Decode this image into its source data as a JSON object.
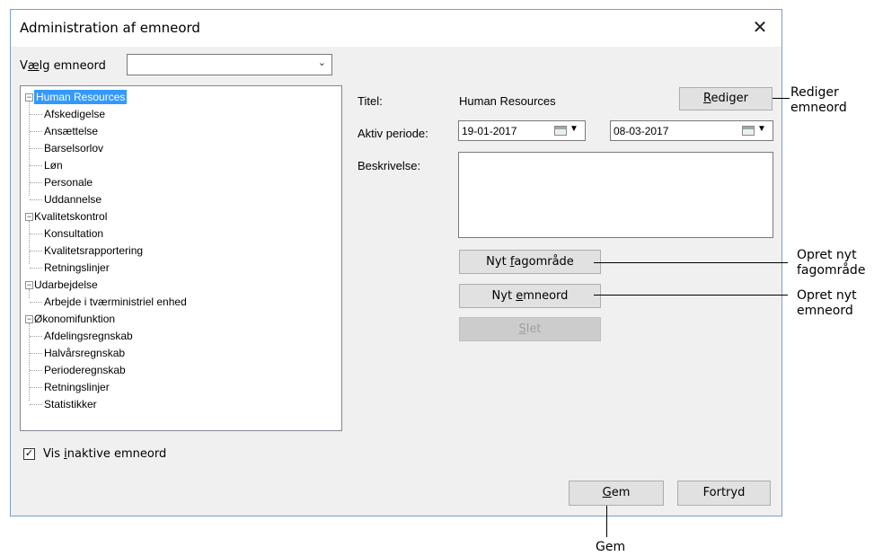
{
  "dialog": {
    "title": "Administration af emneord",
    "close_glyph": "✕"
  },
  "select_keyword": {
    "label_pre": "V",
    "label_acc": "æ",
    "label_post": "lg emneord",
    "value": ""
  },
  "tree": {
    "groups": [
      {
        "label": "Human Resources",
        "selected": true,
        "children": [
          "Afskedigelse",
          "Ansættelse",
          "Barselsorlov",
          "Løn",
          "Personale",
          "Uddannelse"
        ]
      },
      {
        "label": "Kvalitetskontrol",
        "selected": false,
        "children": [
          "Konsultation",
          "Kvalitetsrapportering",
          "Retningslinjer"
        ]
      },
      {
        "label": "Udarbejdelse",
        "selected": false,
        "children": [
          "Arbejde i tværministriel enhed"
        ]
      },
      {
        "label": "Økonomifunktion",
        "selected": false,
        "children": [
          "Afdelingsregnskab",
          "Halvårsregnskab",
          "Perioderegnskab",
          "Retningslinjer",
          "Statistikker"
        ]
      }
    ]
  },
  "details": {
    "title_label": "Titel:",
    "title_value": "Human Resources",
    "period_label": "Aktiv periode:",
    "period_from": "19-01-2017",
    "period_to": "08-03-2017",
    "description_label": "Beskrivelse:",
    "description_value": ""
  },
  "buttons": {
    "edit": {
      "pre": "",
      "acc": "R",
      "post": "ediger"
    },
    "new_area": {
      "pre": "Nyt ",
      "acc": "f",
      "post": "agområde"
    },
    "new_keyword": {
      "pre": "Nyt ",
      "acc": "e",
      "post": "mneord"
    },
    "delete": {
      "pre": "",
      "acc": "S",
      "post": "let"
    },
    "save": {
      "pre": "",
      "acc": "G",
      "post": "em"
    },
    "cancel": {
      "pre": "",
      "acc": "",
      "post": "Fortryd"
    }
  },
  "show_inactive": {
    "checked": true,
    "check_glyph": "✓",
    "label_pre": "Vis ",
    "label_acc": "i",
    "label_post": "naktive emneord"
  },
  "annotations": {
    "edit": [
      "Rediger",
      "emneord"
    ],
    "new_area": [
      "Opret nyt",
      "fagområde"
    ],
    "new_keyword": [
      "Opret nyt",
      "emneord"
    ],
    "save": "Gem"
  }
}
